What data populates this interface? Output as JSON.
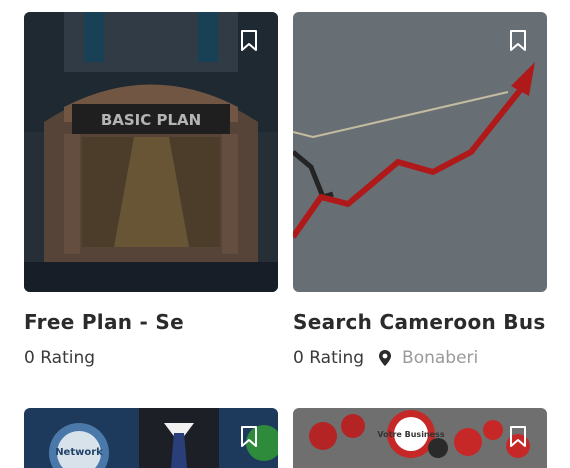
{
  "listings": [
    {
      "title": "Free Plan - Se",
      "rating": "0 Rating",
      "image_text": "BASIC PLAN",
      "location": ""
    },
    {
      "title": "Search Cameroon Busi",
      "rating": "0 Rating",
      "location": "Bonaberi"
    }
  ],
  "partial_listings": [
    {
      "image_text": "Network"
    },
    {
      "image_text": "Votre Business"
    }
  ],
  "colors": {
    "overlay": "#000000",
    "trend_red": "#d01b1b",
    "location_gray": "#9a9a9a"
  },
  "icons": {
    "bookmark": "bookmark-icon",
    "location": "map-pin-icon"
  }
}
